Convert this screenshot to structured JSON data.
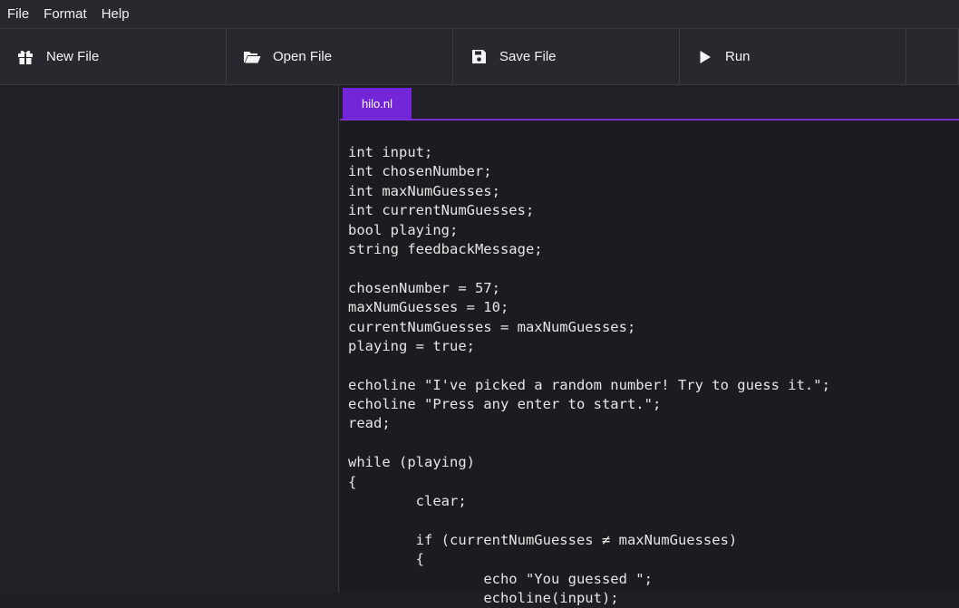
{
  "menu": {
    "items": [
      "File",
      "Format",
      "Help"
    ]
  },
  "toolbar": {
    "new_file": "New File",
    "open_file": "Open File",
    "save_file": "Save File",
    "run": "Run",
    "icons": {
      "new_file": "gift-icon",
      "open_file": "folder-open-icon",
      "save_file": "floppy-disk-icon",
      "run": "play-icon"
    }
  },
  "editor": {
    "tab_label": "hilo.nl",
    "accent_color": "#7326d8",
    "lines": [
      "int input;",
      "int chosenNumber;",
      "int maxNumGuesses;",
      "int currentNumGuesses;",
      "bool playing;",
      "string feedbackMessage;",
      "",
      "chosenNumber = 57;",
      "maxNumGuesses = 10;",
      "currentNumGuesses = maxNumGuesses;",
      "playing = true;",
      "",
      "echoline \"I've picked a random number! Try to guess it.\";",
      "echoline \"Press any enter to start.\";",
      "read;",
      "",
      "while (playing)",
      "{",
      "\tclear;",
      "",
      "\tif (currentNumGuesses ≠ maxNumGuesses)",
      "\t{",
      "\t\techo \"You guessed \";",
      "\t\techoline(input);"
    ]
  }
}
